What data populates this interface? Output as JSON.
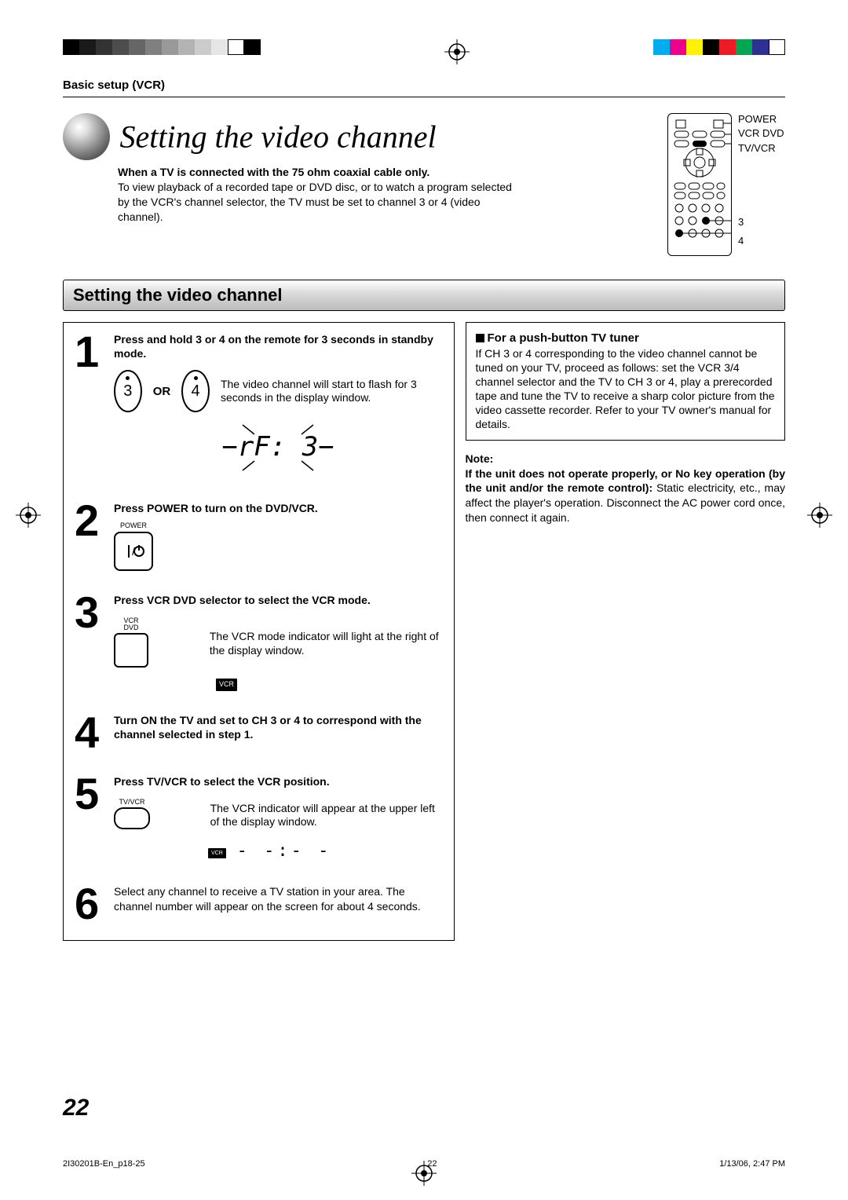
{
  "breadcrumb": "Basic setup (VCR)",
  "page_title": "Setting the video channel",
  "intro_bold": "When a TV is connected with the 75 ohm coaxial cable only.",
  "intro_body": "To view playback of a recorded tape or DVD disc, or to watch a program selected by the VCR's channel selector, the TV must be set to channel 3 or 4 (video channel).",
  "remote_labels": {
    "power": "POWER",
    "vcr_dvd": "VCR DVD",
    "tv_vcr": "TV/VCR",
    "three": "3",
    "four": "4"
  },
  "section_heading": "Setting the video channel",
  "steps": [
    {
      "num": "1",
      "heading": "Press and hold 3 or 4 on the remote for 3 seconds in standby mode.",
      "or": "OR",
      "btn_a": "3",
      "btn_b": "4",
      "desc": "The video channel will start to flash for 3 seconds in the display window.",
      "display_text": "−rF: 3−"
    },
    {
      "num": "2",
      "heading": "Press POWER to turn on the DVD/VCR.",
      "power_label": "POWER"
    },
    {
      "num": "3",
      "heading": "Press VCR DVD selector to select the VCR mode.",
      "btn_label": "VCR\nDVD",
      "desc": "The VCR mode indicator will light at the right of the display window.",
      "badge": "VCR"
    },
    {
      "num": "4",
      "heading": "Turn ON the TV and set to CH 3 or 4 to correspond with the channel selected in step 1."
    },
    {
      "num": "5",
      "heading": "Press TV/VCR to select the VCR position.",
      "btn_label": "TV/VCR",
      "desc": "The VCR indicator will appear at the upper left of the display window.",
      "badge": "VCR",
      "display_dashes": "- -:- -"
    },
    {
      "num": "6",
      "heading": "Select any channel to receive a TV station in your area. The channel number will appear on the screen for about 4 seconds."
    }
  ],
  "side_box": {
    "title": "For a push-button TV tuner",
    "body": "If CH 3 or 4 corresponding to the video channel cannot be tuned on your TV, proceed as follows: set the VCR 3/4 channel selector and the TV to CH 3 or 4, play a prerecorded tape and tune the TV to receive a sharp color picture from the video cassette recorder. Refer to your TV owner's manual for details."
  },
  "note": {
    "label": "Note:",
    "body_bold": "If the unit does not operate properly, or No key operation (by the unit and/or the remote control):",
    "body": " Static electricity, etc., may affect the player's operation. Disconnect the AC power cord once, then connect it again."
  },
  "page_number": "22",
  "footer": {
    "left": "2I30201B-En_p18-25",
    "center": "22",
    "right": "1/13/06, 2:47 PM"
  },
  "colors": {
    "grays": [
      "#000",
      "#1a1a1a",
      "#333",
      "#4d4d4d",
      "#666",
      "#808080",
      "#999",
      "#b3b3b3",
      "#ccc",
      "#e6e6e6",
      "#fff",
      "#000"
    ],
    "cmyk": [
      "#00aeef",
      "#ec008c",
      "#fff200",
      "#000",
      "#ed1c24",
      "#00a651",
      "#2e3192",
      "#fff"
    ]
  }
}
